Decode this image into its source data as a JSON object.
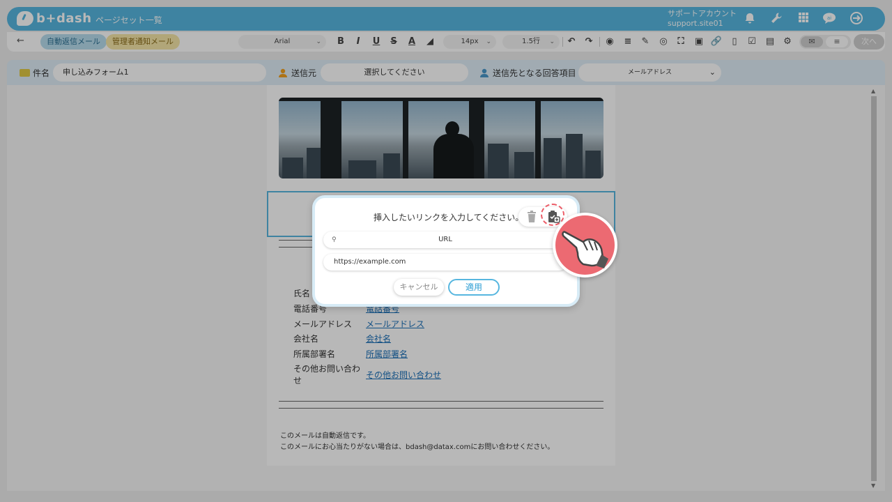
{
  "header": {
    "brand": "b+dash",
    "page_set_link": "ページセット一覧",
    "account_name": "サポートアカウント",
    "account_site": "support.site01"
  },
  "toolbar": {
    "tabs": [
      {
        "label": "自動返信メール",
        "active": true
      },
      {
        "label": "管理者通知メール",
        "active": false
      }
    ],
    "font_family": "Arial",
    "font_size": "14px",
    "line_height": "1.5行",
    "next_label": "次へ"
  },
  "settings": {
    "subject_label": "件名",
    "subject_value": "申し込みフォーム1",
    "sender_label": "送信元",
    "sender_placeholder": "選択してください",
    "recipient_label": "送信先となる回答項目",
    "recipient_value": "メールアドレス"
  },
  "mail": {
    "fields": [
      {
        "label": "氏名",
        "value": ""
      },
      {
        "label": "電話番号",
        "value": "電話番号"
      },
      {
        "label": "メールアドレス",
        "value": "メールアドレス"
      },
      {
        "label": "会社名",
        "value": "会社名"
      },
      {
        "label": "所属部署名",
        "value": "所属部署名"
      },
      {
        "label": "その他お問い合わ",
        "label2": "せ",
        "value": "その他お問い合わせ"
      }
    ],
    "footer_line1": "このメールは自動返信です。",
    "footer_line2": "このメールにお心当たりがない場合は、bdash@datax.comにお問い合わせください。"
  },
  "dialog": {
    "title": "挿入したいリンクを入力してください。",
    "search_placeholder": "URL",
    "url_value": "https://example.com",
    "cancel_label": "キャンセル",
    "apply_label": "適用"
  },
  "colors": {
    "brand": "#56b6df",
    "annotation": "#ec6a72"
  },
  "icons": {
    "header": [
      "bell-icon",
      "wrench-icon",
      "apps-grid-icon",
      "chat-bubble-icon",
      "logout-icon"
    ],
    "dialog": [
      "trash-icon",
      "clipboard-paste-icon"
    ]
  }
}
